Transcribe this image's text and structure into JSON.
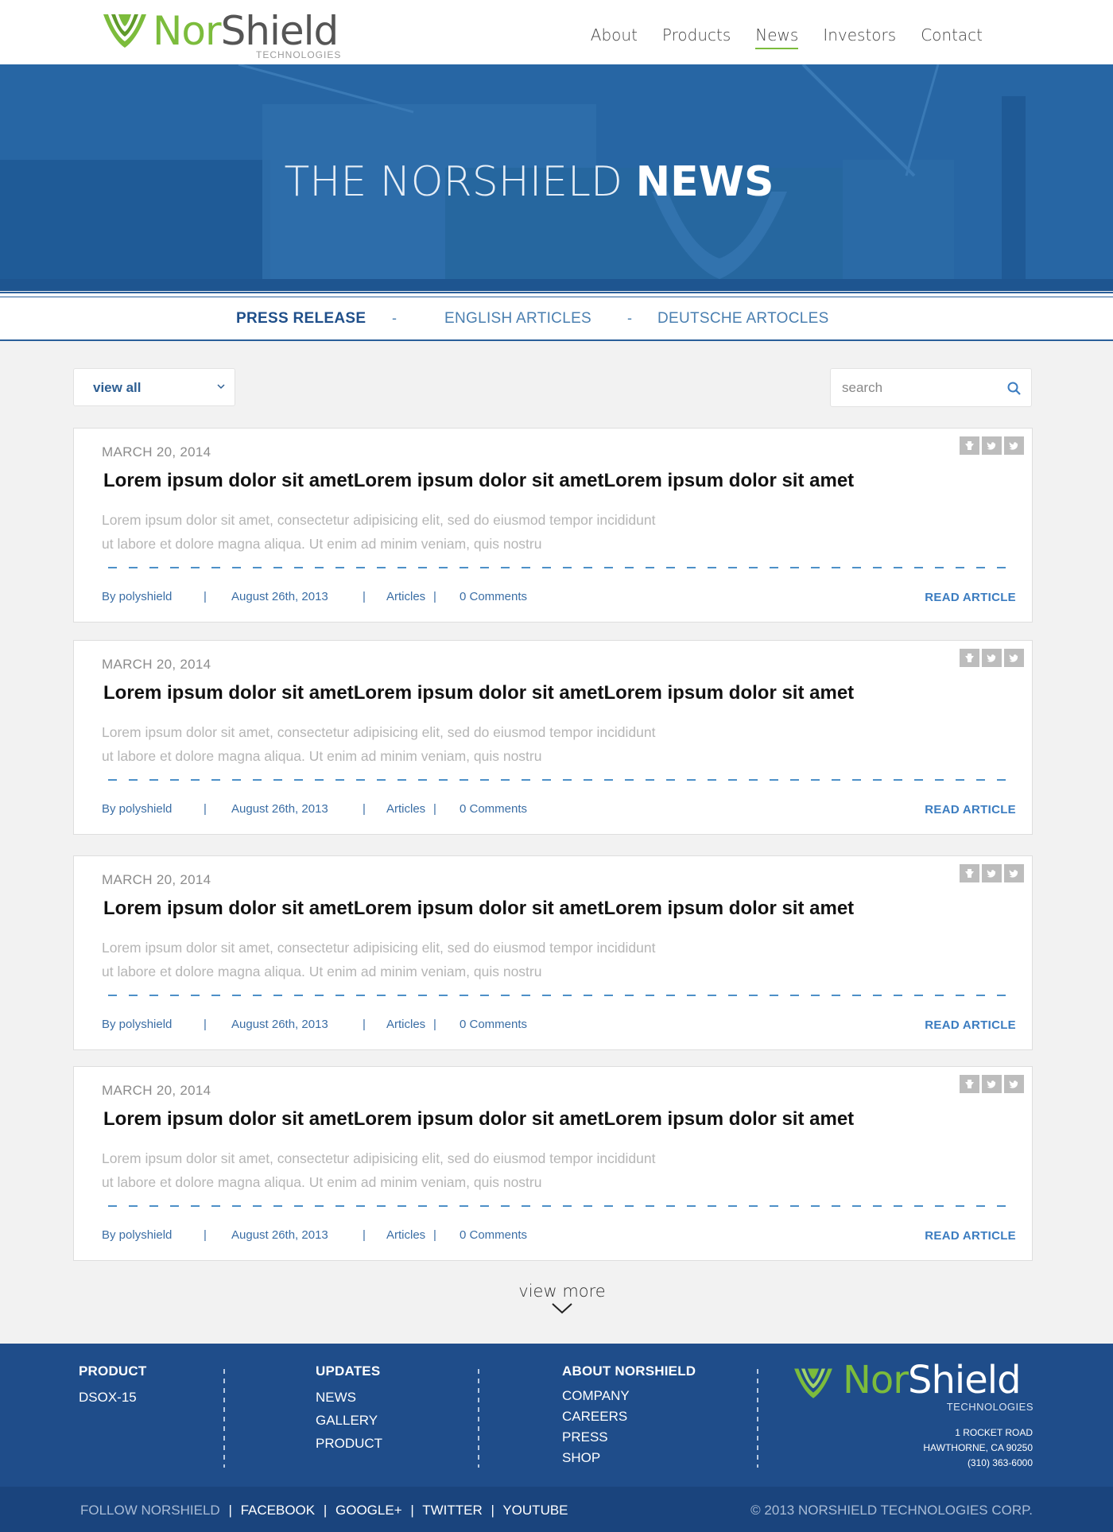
{
  "brand": {
    "name_part1": "Nor",
    "name_part2": "Shield",
    "subtitle": "TECHNOLOGIES",
    "accent": "#7cbc3c",
    "primary": "#24629f"
  },
  "nav": {
    "items": [
      {
        "label": "About"
      },
      {
        "label": "Products"
      },
      {
        "label": "News",
        "active": true
      },
      {
        "label": "Investors"
      },
      {
        "label": "Contact"
      }
    ]
  },
  "hero": {
    "title_light": "THE NORSHIELD ",
    "title_bold": "NEWS"
  },
  "filters": {
    "items": [
      {
        "label": "PRESS RELEASE",
        "active": true
      },
      {
        "label": "ENGLISH ARTICLES"
      },
      {
        "label": "DEUTSCHE ARTOCLES"
      }
    ],
    "separator": "-"
  },
  "controls": {
    "select_value": "view all",
    "search_placeholder": "search"
  },
  "articles": [
    {
      "date": "MARCH 20, 2014",
      "title": "Lorem ipsum dolor sit ametLorem ipsum dolor sit ametLorem ipsum dolor sit amet",
      "excerpt_line1": "Lorem ipsum dolor sit amet, consectetur adipisicing elit, sed do eiusmod tempor incididunt",
      "excerpt_line2": "ut labore et dolore magna aliqua. Ut enim ad minim veniam, quis nostru",
      "author": "By polyshield",
      "posted": "August 26th, 2013",
      "category": "Articles",
      "comments": "0 Comments",
      "read_label": "READ ARTICLE"
    },
    {
      "date": "MARCH 20, 2014",
      "title": "Lorem ipsum dolor sit ametLorem ipsum dolor sit ametLorem ipsum dolor sit amet",
      "excerpt_line1": "Lorem ipsum dolor sit amet, consectetur adipisicing elit, sed do eiusmod tempor incididunt",
      "excerpt_line2": "ut labore et dolore magna aliqua. Ut enim ad minim veniam, quis nostru",
      "author": "By polyshield",
      "posted": "August 26th, 2013",
      "category": "Articles",
      "comments": "0 Comments",
      "read_label": "READ ARTICLE"
    },
    {
      "date": "MARCH 20, 2014",
      "title": "Lorem ipsum dolor sit ametLorem ipsum dolor sit ametLorem ipsum dolor sit amet",
      "excerpt_line1": "Lorem ipsum dolor sit amet, consectetur adipisicing elit, sed do eiusmod tempor incididunt",
      "excerpt_line2": "ut labore et dolore magna aliqua. Ut enim ad minim veniam, quis nostru",
      "author": "By polyshield",
      "posted": "August 26th, 2013",
      "category": "Articles",
      "comments": "0 Comments",
      "read_label": "READ ARTICLE"
    },
    {
      "date": "MARCH 20, 2014",
      "title": "Lorem ipsum dolor sit ametLorem ipsum dolor sit ametLorem ipsum dolor sit amet",
      "excerpt_line1": "Lorem ipsum dolor sit amet, consectetur adipisicing elit, sed do eiusmod tempor incididunt",
      "excerpt_line2": "ut labore et dolore magna aliqua. Ut enim ad minim veniam, quis nostru",
      "author": "By polyshield",
      "posted": "August 26th, 2013",
      "category": "Articles",
      "comments": "0 Comments",
      "read_label": "READ ARTICLE"
    }
  ],
  "meta_separator": "|",
  "view_more": "view more",
  "footer": {
    "product": {
      "title": "PRODUCT",
      "items": [
        "DSOX-15"
      ]
    },
    "updates": {
      "title": "UPDATES",
      "items": [
        "NEWS",
        "GALLERY",
        "PRODUCT"
      ]
    },
    "about": {
      "title": "ABOUT NORSHIELD",
      "items": [
        "COMPANY",
        "CAREERS",
        "PRESS",
        "SHOP"
      ]
    },
    "address": {
      "line1": "1 ROCKET ROAD",
      "line2": "HAWTHORNE, CA 90250",
      "line3": "(310) 363-6000"
    },
    "follow_label": "FOLLOW NORSHIELD",
    "social": [
      "FACEBOOK",
      "GOOGLE+",
      "TWITTER",
      "YOUTUBE"
    ],
    "copyright": "© 2013 NORSHIELD TECHNOLOGIES CORP."
  }
}
